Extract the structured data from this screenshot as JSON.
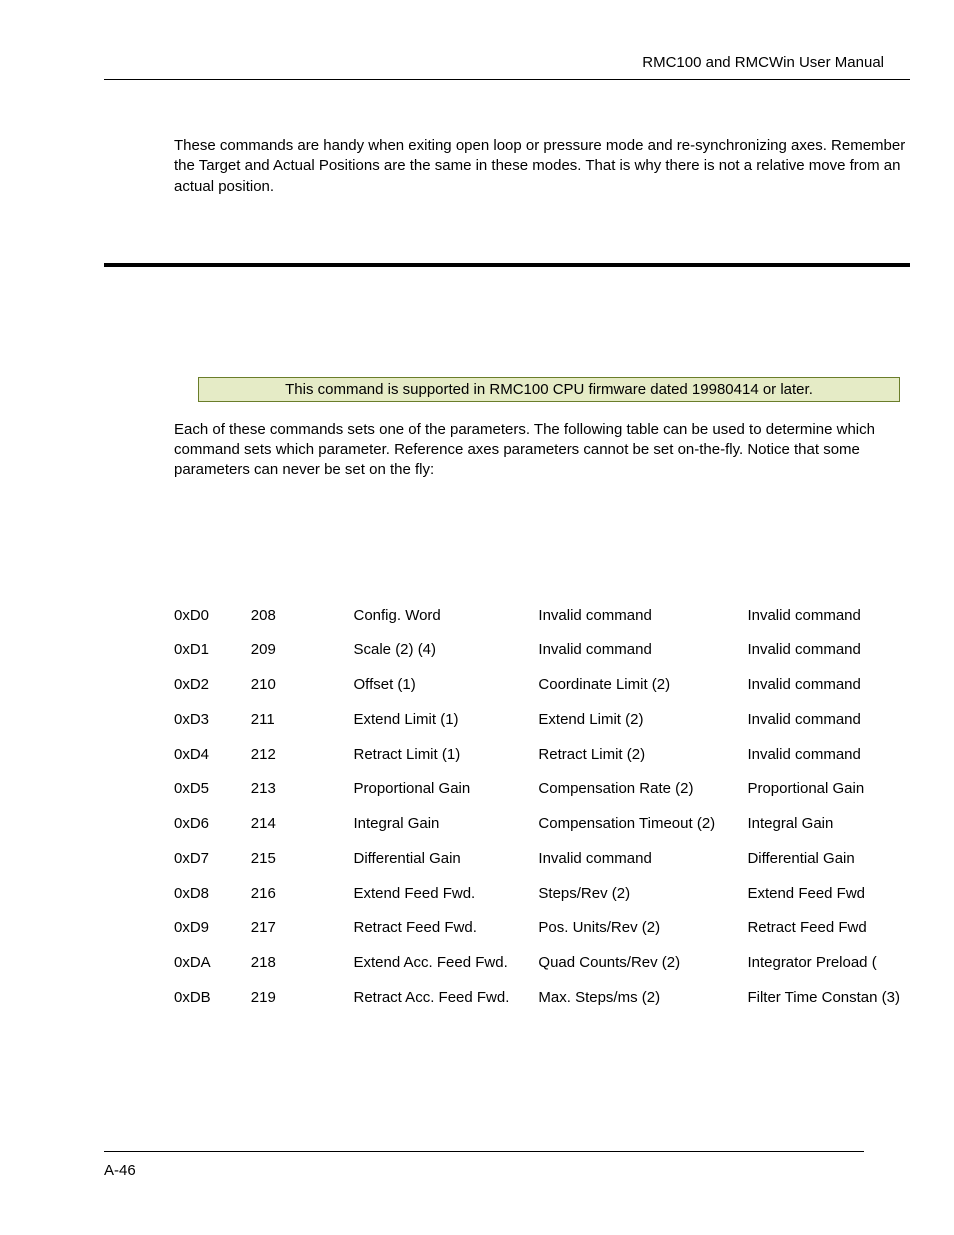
{
  "header": {
    "title": "RMC100 and RMCWin User Manual"
  },
  "intro": {
    "paragraph": "These commands are handy when exiting open loop or pressure mode and re-synchronizing axes. Remember the Target and Actual Positions are the same in these modes. That is why there is not a relative move from an actual position."
  },
  "note": "This command is supported in RMC100 CPU firmware dated 19980414 or later.",
  "desc": {
    "paragraph": "Each of these commands sets one of the parameters. The following table can be used to determine which command sets which parameter. Reference axes parameters cannot be set on-the-fly. Notice that some parameters can never be set on the fly:"
  },
  "table": {
    "rows": [
      {
        "hex": "0xD0",
        "dec": "208",
        "c1": "Config. Word",
        "c2": "Invalid command",
        "c3": "Invalid command"
      },
      {
        "hex": "0xD1",
        "dec": "209",
        "c1": "Scale (2) (4)",
        "c2": "Invalid command",
        "c3": "Invalid command"
      },
      {
        "hex": "0xD2",
        "dec": "210",
        "c1": "Offset (1)",
        "c2": "Coordinate Limit (2)",
        "c3": "Invalid command"
      },
      {
        "hex": "0xD3",
        "dec": "211",
        "c1": "Extend Limit (1)",
        "c2": "Extend Limit (2)",
        "c3": "Invalid command"
      },
      {
        "hex": "0xD4",
        "dec": "212",
        "c1": "Retract Limit (1)",
        "c2": "Retract Limit (2)",
        "c3": "Invalid command"
      },
      {
        "hex": "0xD5",
        "dec": "213",
        "c1": "Proportional Gain",
        "c2": "Compensation Rate (2)",
        "c3": "Proportional Gain"
      },
      {
        "hex": "0xD6",
        "dec": "214",
        "c1": "Integral Gain",
        "c2": "Compensation Timeout (2)",
        "c3": "Integral Gain"
      },
      {
        "hex": "0xD7",
        "dec": "215",
        "c1": "Differential Gain",
        "c2": "Invalid command",
        "c3": "Differential Gain"
      },
      {
        "hex": "0xD8",
        "dec": "216",
        "c1": "Extend Feed Fwd.",
        "c2": "Steps/Rev (2)",
        "c3": "Extend Feed Fwd"
      },
      {
        "hex": "0xD9",
        "dec": "217",
        "c1": "Retract Feed Fwd.",
        "c2": "Pos. Units/Rev (2)",
        "c3": "Retract Feed Fwd"
      },
      {
        "hex": "0xDA",
        "dec": "218",
        "c1": "Extend Acc. Feed Fwd.",
        "c2": "Quad Counts/Rev (2)",
        "c3": "Integrator Preload ("
      },
      {
        "hex": "0xDB",
        "dec": "219",
        "c1": "Retract Acc. Feed Fwd.",
        "c2": "Max. Steps/ms (2)",
        "c3": "Filter Time Constan (3)"
      }
    ]
  },
  "footer": {
    "page_label": "A-46"
  }
}
